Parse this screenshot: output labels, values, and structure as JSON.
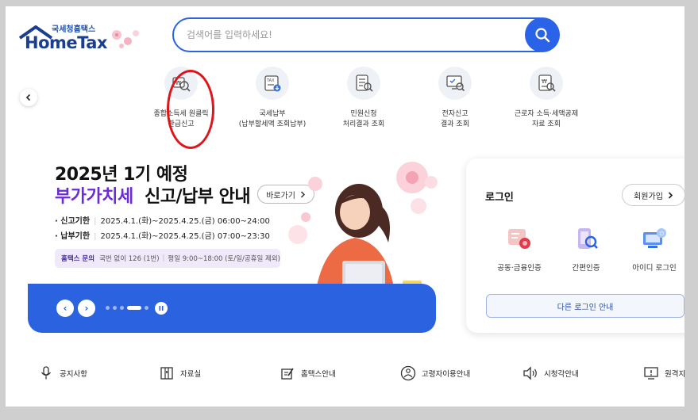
{
  "logo": {
    "sub": "국세청홈택스",
    "main": "HomeTax"
  },
  "search": {
    "placeholder": "검색어를 입력하세요!"
  },
  "quick_menu": [
    {
      "icon": "tax-refund-search-icon",
      "label": "종합소득세 원클릭\n환급신고"
    },
    {
      "icon": "tax-payment-icon",
      "label": "국세납부\n(납부할세액 조회납부)"
    },
    {
      "icon": "document-search-icon",
      "label": "민원신청\n처리결과 조회"
    },
    {
      "icon": "electronic-filing-icon",
      "label": "전자신고\n결과 조회"
    },
    {
      "icon": "deduction-data-icon",
      "label": "근로자 소득·세액공제\n자료 조회"
    }
  ],
  "banner": {
    "title_line1": "2025년 1기 예정",
    "title_highlight": "부가가치세",
    "title_rest": "신고/납부 안내",
    "more_label": "바로가기",
    "rows": [
      {
        "label": "· 신고기한",
        "value": "2025.4.1.(화)~2025.4.25.(금) 06:00~24:00"
      },
      {
        "label": "· 납부기한",
        "value": "2025.4.1.(화)~2025.4.25.(금) 07:00~23:30"
      }
    ],
    "contact_title": "홈택스 문의",
    "contact_phone": "국번 없이 126 (1번)",
    "contact_hours": "평일 9:00~18:00 (토/일/공휴일 제외)"
  },
  "slider": {
    "prev": "‹",
    "next": "›"
  },
  "login": {
    "title": "로그인",
    "join_label": "회원가입",
    "options": [
      {
        "icon": "certificate-icon",
        "label": "공동·금융인증"
      },
      {
        "icon": "mobile-auth-icon",
        "label": "간편인증"
      },
      {
        "icon": "id-login-icon",
        "label": "아이디 로그인"
      }
    ],
    "other_label": "다른 로그인 안내"
  },
  "bottom_menu": [
    {
      "icon": "microphone-icon",
      "label": "공지사항"
    },
    {
      "icon": "archive-icon",
      "label": "자료실"
    },
    {
      "icon": "guide-icon",
      "label": "홈택스안내"
    },
    {
      "icon": "senior-icon",
      "label": "고령자이용안내"
    },
    {
      "icon": "speaker-icon",
      "label": "시청각안내"
    },
    {
      "icon": "remote-icon",
      "label": "원격지"
    }
  ],
  "colors": {
    "brand_blue": "#2b62e0",
    "highlight_purple": "#6b2bd8",
    "annotation_red": "#e0151b"
  }
}
